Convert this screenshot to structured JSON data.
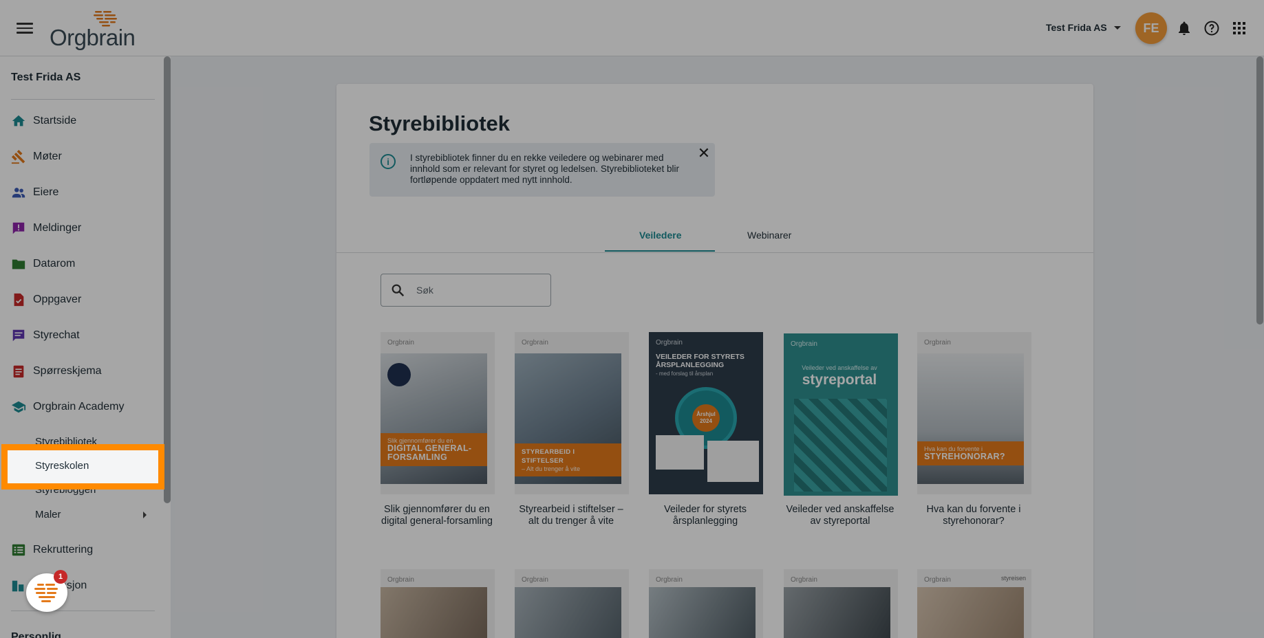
{
  "header": {
    "logo_text": "Orgbrain",
    "org_name": "Test Frida AS",
    "avatar_initials": "FE"
  },
  "sidebar": {
    "org_title": "Test Frida AS",
    "items": [
      {
        "label": "Startside",
        "icon": "home-icon",
        "color": "#1c8a92"
      },
      {
        "label": "Møter",
        "icon": "gavel-icon",
        "color": "#e47a1b"
      },
      {
        "label": "Eiere",
        "icon": "people-icon",
        "color": "#3b5bb5"
      },
      {
        "label": "Meldinger",
        "icon": "message-alert-icon",
        "color": "#8e24aa"
      },
      {
        "label": "Datarom",
        "icon": "folder-icon",
        "color": "#2e7d32"
      },
      {
        "label": "Oppgaver",
        "icon": "task-icon",
        "color": "#c62828"
      },
      {
        "label": "Styrechat",
        "icon": "chat-icon",
        "color": "#5e35b1"
      },
      {
        "label": "Spørreskjema",
        "icon": "clipboard-icon",
        "color": "#c62828"
      },
      {
        "label": "Orgbrain Academy",
        "icon": "school-icon",
        "color": "#1c8a92"
      },
      {
        "label": "Rekruttering",
        "icon": "list-icon",
        "color": "#2e7d32"
      },
      {
        "label": "sasjon",
        "icon": "org-icon",
        "color": "#1c8a92"
      }
    ],
    "academy_sub": [
      "Styrebibliotek",
      "Styreskolen",
      "Styrebloggen",
      "Maler"
    ],
    "section_personlig": "Personlig"
  },
  "main": {
    "title": "Styrebibliotek",
    "info_text": "I styrebibliotek finner du en rekke veiledere og webinarer med innhold som er relevant for styret og ledelsen. Styrebiblioteket blir fortløpende oppdatert med nytt innhold.",
    "tabs": [
      "Veiledere",
      "Webinarer"
    ],
    "search_placeholder": "Søk",
    "books": [
      {
        "caption": "Slik gjennomfører du en digital general-forsamling",
        "band_small": "Slik gjennomfører du en",
        "band_big": "DIGITAL GENERAL-FORSAMLING"
      },
      {
        "caption": "Styrearbeid i stiftelser – alt du trenger å vite",
        "band_small": "– Alt du trenger å vite",
        "band_big": "STYREARBEID I STIFTELSER"
      },
      {
        "caption": "Veileder for styrets årsplanlegging",
        "cover_title": "VEILEDER FOR STYRETS ÅRSPLANLEGGING",
        "cover_sub": "- med forslag til årsplan",
        "wheel_label": "Årshjul",
        "wheel_year": "2024"
      },
      {
        "caption": "Veileder ved anskaffelse av styreportal",
        "cover_small": "Veileder ved anskaffelse av",
        "cover_big": "styreportal"
      },
      {
        "caption": "Hva kan du forvente i styrehonorar?",
        "band_small": "Hva kan du forvente i",
        "band_big": "STYREHONORAR?"
      }
    ],
    "second_row_logo": "Orgbrain",
    "second_row_badge": "styreisen"
  },
  "fab": {
    "badge": "1"
  }
}
